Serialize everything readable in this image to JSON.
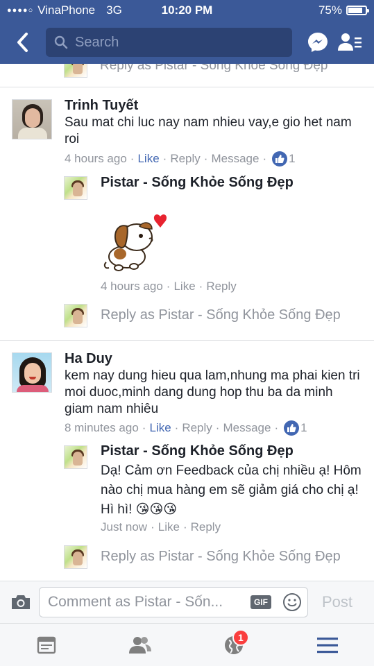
{
  "status_bar": {
    "carrier": "VinaPhone",
    "network": "3G",
    "time": "10:20 PM",
    "battery": "75%",
    "battery_level": 0.75
  },
  "navbar": {
    "search_placeholder": "Search",
    "icons": [
      "back-chevron-icon",
      "search-icon",
      "messenger-icon",
      "friend-requests-icon"
    ]
  },
  "peek_reply_as": "Reply as Pistar - Sống Khỏe Sống Đẹp",
  "comments": [
    {
      "author": "Trinh Tuyết",
      "text": "Sau mat chi luc nay nam nhieu vay,e gio het nam roi",
      "time": "4 hours ago",
      "like_label": "Like",
      "reply_label": "Reply",
      "message_label": "Message",
      "like_count": "1",
      "reply": {
        "author": "Pistar - Sống Khỏe Sống Đẹp",
        "sticker": "puppy-kiss-heart-sticker",
        "time": "4 hours ago",
        "like_label": "Like",
        "reply_label": "Reply"
      },
      "reply_as": "Reply as Pistar - Sống Khỏe Sống Đẹp"
    },
    {
      "author": "Ha Duy",
      "text": "kem nay dung hieu qua lam,nhung ma phai kien tri moi duoc,minh dang dung hop thu ba da minh giam nam nhiêu",
      "time": "8 minutes ago",
      "like_label": "Like",
      "reply_label": "Reply",
      "message_label": "Message",
      "like_count": "1",
      "reply": {
        "author": "Pistar - Sống Khỏe Sống Đẹp",
        "text": "Dạ! Cảm ơn Feedback của chị nhiều ạ! Hôm nào chị mua hàng em sẽ giảm giá cho chị ạ! Hì hì! 😘😘😘",
        "time": "Just now",
        "like_label": "Like",
        "reply_label": "Reply"
      },
      "reply_as": "Reply as Pistar - Sống Khỏe Sống Đẹp"
    }
  ],
  "composer": {
    "placeholder": "Comment as Pistar - Sốn...",
    "gif_label": "GIF",
    "post_label": "Post"
  },
  "tabbar": {
    "tabs": [
      "news-feed-icon",
      "friends-icon",
      "notifications-globe-icon",
      "menu-icon"
    ],
    "notification_count": "1"
  },
  "colors": {
    "header_bg": "#3b5998",
    "link_blue": "#4267b2",
    "meta_gray": "#90949c",
    "badge_red": "#fa3e3e"
  }
}
